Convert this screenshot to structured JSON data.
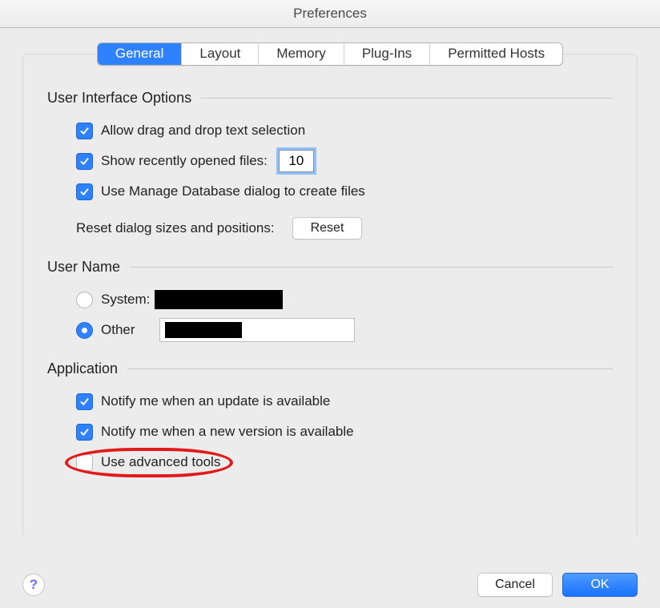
{
  "window": {
    "title": "Preferences"
  },
  "tabs": {
    "general": "General",
    "layout": "Layout",
    "memory": "Memory",
    "plugins": "Plug-Ins",
    "permitted_hosts": "Permitted Hosts",
    "active": "general"
  },
  "sections": {
    "ui_options": {
      "title": "User Interface Options",
      "allow_drag": "Allow drag and drop text selection",
      "show_recent": "Show recently opened files:",
      "show_recent_value": "10",
      "use_manage_db": "Use Manage Database dialog to create files",
      "reset_label": "Reset dialog sizes and positions:",
      "reset_button": "Reset"
    },
    "user_name": {
      "title": "User Name",
      "system_label": "System:",
      "other_label": "Other",
      "selected": "other",
      "other_value": ""
    },
    "application": {
      "title": "Application",
      "notify_update": "Notify me when an update is available",
      "notify_version": "Notify me when a new version is available",
      "use_advanced": "Use advanced tools"
    }
  },
  "footer": {
    "help": "?",
    "cancel": "Cancel",
    "ok": "OK"
  }
}
